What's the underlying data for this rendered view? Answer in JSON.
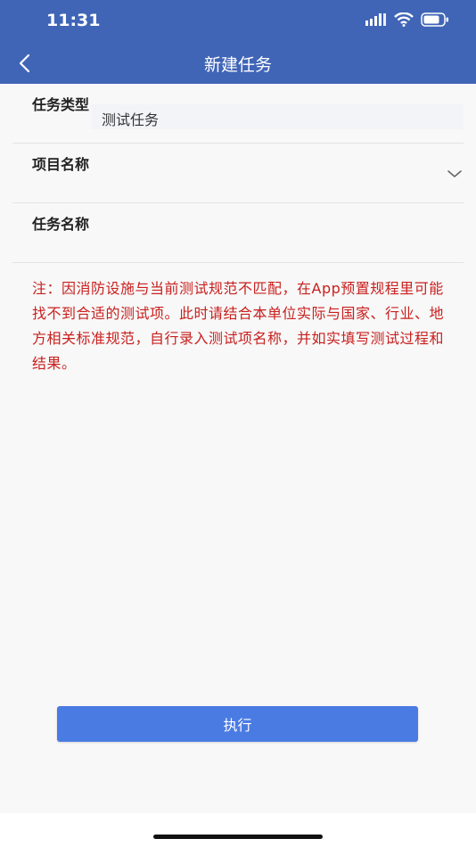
{
  "status_bar": {
    "time": "11:31"
  },
  "nav": {
    "title": "新建任务"
  },
  "form": {
    "task_type": {
      "label": "任务类型",
      "value": "测试任务"
    },
    "project_name": {
      "label": "项目名称",
      "value": ""
    },
    "task_name": {
      "label": "任务名称",
      "value": ""
    }
  },
  "note": "注：因消防设施与当前测试规范不匹配，在App预置规程里可能找不到合适的测试项。此时请结合本单位实际与国家、行业、地方相关标准规范，自行录入测试项名称，并如实填写测试过程和结果。",
  "actions": {
    "execute_label": "执行"
  },
  "colors": {
    "header": "#4065B7",
    "note": "#C8201E",
    "button": "#4A7BE2"
  }
}
